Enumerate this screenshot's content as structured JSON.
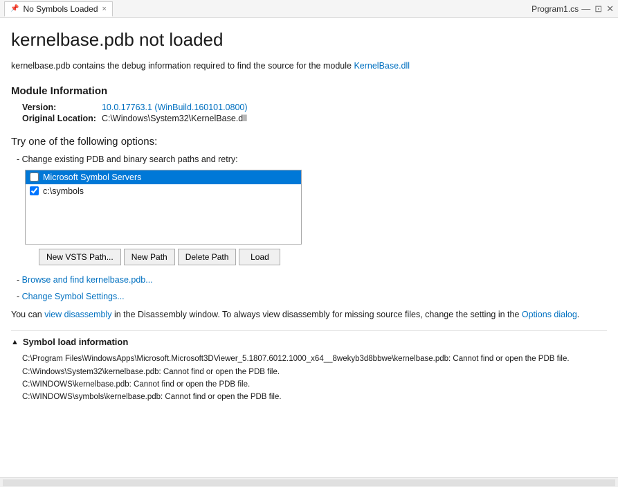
{
  "titleBar": {
    "tabLabel": "No Symbols Loaded",
    "pinIcon": "📌",
    "closeIcon": "×",
    "filename": "Program1.cs",
    "icons": [
      "□",
      "⊞",
      "✕"
    ]
  },
  "page": {
    "title": "kernelbase.pdb not loaded",
    "description": "kernelbase.pdb contains the debug information required to find the source for the module ",
    "descriptionHighlight": "KernelBase.dll",
    "moduleSection": {
      "title": "Module Information",
      "version": {
        "label": "Version:",
        "value": "10.0.17763.1 (WinBuild.160101.0800)"
      },
      "location": {
        "label": "Original Location:",
        "value": "C:\\Windows\\System32\\KernelBase.dll"
      }
    },
    "optionsTitle": "Try one of the following options:",
    "changePathLabel": "Change existing PDB and binary search paths and retry:",
    "pathList": [
      {
        "id": "microsoft-symbol-servers",
        "label": "Microsoft Symbol Servers",
        "checked": false,
        "selected": true
      },
      {
        "id": "c-symbols",
        "label": "c:\\symbols",
        "checked": true,
        "selected": false
      }
    ],
    "buttons": {
      "newVSTS": "New VSTS Path...",
      "newPath": "New Path",
      "deletePath": "Delete Path",
      "load": "Load"
    },
    "browseLink": "Browse and find kernelbase.pdb...",
    "changeSymbolLink": "Change Symbol Settings...",
    "disassemblyText1": "You can ",
    "disassemblyLink": "view disassembly",
    "disassemblyText2": " in the Disassembly window. To always view disassembly for missing source files, change the setting in the ",
    "optionsDialogLink": "Options dialog",
    "disassemblyText3": ".",
    "symbolLoadSection": {
      "title": "Symbol load information",
      "logs": [
        "C:\\Program Files\\WindowsApps\\Microsoft.Microsoft3DViewer_5.1807.6012.1000_x64__8wekyb3d8bbwe\\kernelbase.pdb: Cannot find or open the PDB file.",
        "C:\\Windows\\System32\\kernelbase.pdb: Cannot find or open the PDB file.",
        "C:\\WINDOWS\\kernelbase.pdb: Cannot find or open the PDB file.",
        "C:\\WINDOWS\\symbols\\kernelbase.pdb: Cannot find or open the PDB file."
      ]
    }
  }
}
